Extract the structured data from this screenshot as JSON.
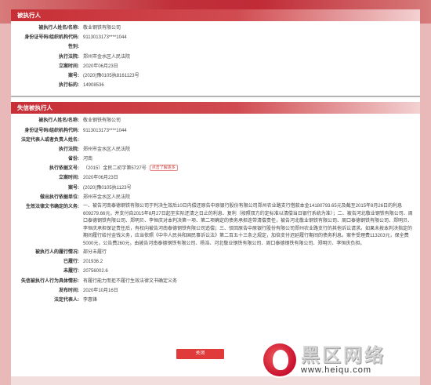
{
  "section1": {
    "title": "被执行人",
    "rows": [
      {
        "label": "被执行人姓名/名称:",
        "value": "敬业钢铁有限公司"
      },
      {
        "label": "身份证号码/组织机构代码:",
        "value": "9113013173****1044"
      },
      {
        "label": "性别:",
        "value": ""
      },
      {
        "label": "执行法院:",
        "value": "郑州市金水区人民法院"
      },
      {
        "label": "立案时间:",
        "value": "2020年06月23日"
      },
      {
        "label": "案号:",
        "value": "(2020)豫0105执8161123号"
      },
      {
        "label": "执行标的:",
        "value": "14908536"
      }
    ]
  },
  "section2": {
    "title": "失信被执行人",
    "rows": [
      {
        "label": "被执行人姓名/名称:",
        "value": "敬业钢铁有限公司"
      },
      {
        "label": "身份证号码/组织机构代码:",
        "value": "9113013173****1044"
      },
      {
        "label": "法定代表人或者负责人姓名:",
        "value": ""
      },
      {
        "label": "执行法院:",
        "value": "郑州市金水区人民法院"
      },
      {
        "label": "省份:",
        "value": "河南"
      },
      {
        "label": "执行依据文号:",
        "value": "（2015）金民二初字第5727号",
        "tag": "点击了解更多"
      },
      {
        "label": "立案时间:",
        "value": "2020年06月23日"
      },
      {
        "label": "案号:",
        "value": "(2020)豫0105执1123号"
      },
      {
        "label": "做出执行依据单位:",
        "value": "郑州市金水区人民法院"
      }
    ],
    "obligation_label": "生效法律文书确定的义务:",
    "obligation_text": "一、被告河南泰德钢铁有限公司于判决生效后10日内偿还原告中原银行股份有限公司郑州农业路支行借款本金14180793.65元及截至2015年8月26日的利息609279.66元，并支付自2015年8月27日起至实际还清之日止的利息、复利（按照双方约定标准以清偿当日银行系统为准）；二、被告河北敬业钢铁有限公司、周口泰德钢铁有限公司、郑明贝、李恒庆对本判决第一项、第二项确定的债务承担连带清偿责任，被告河北敬业钢铁有限公司、周口泰德钢铁有限公司、郑明贝、李恒庆承担保证责任后，有权向被告河南泰德钢铁有限公司追偿；三、驳回原告中原银行股份有限公司郑州农业路支行的其他诉讼请求。如果未按本判决指定的期间履行给付金钱义务，应当依照《中华人民共和国民事诉讼法》第二百五十三条之规定，加倍支付迟延履行期间的债务利息。案件受理费113203元，保全费5000元，公告费260元，由被告河南泰德钢铁有限公司、杨浩、河北敬业钢铁有限公司、周口泰德钢铁有限公司、郑明贝、李恒庆负担。",
    "rows_after": [
      {
        "label": "被执行人的履行情况:",
        "value": "部分未履行"
      },
      {
        "label": "已履行:",
        "value": "201936.2"
      },
      {
        "label": "未履行:",
        "value": "20756002.6"
      },
      {
        "label": "失信被执行人行为具体情形:",
        "value": "有履行能力而拒不履行生效法律文书确定义务"
      },
      {
        "label": "发布时间:",
        "value": "2020年10月16日"
      },
      {
        "label": "法定代表人:",
        "value": "李惠锋"
      }
    ]
  },
  "close_button": "关闭",
  "watermark": {
    "name": "黑区网络",
    "url": "www.heiqu.com"
  }
}
